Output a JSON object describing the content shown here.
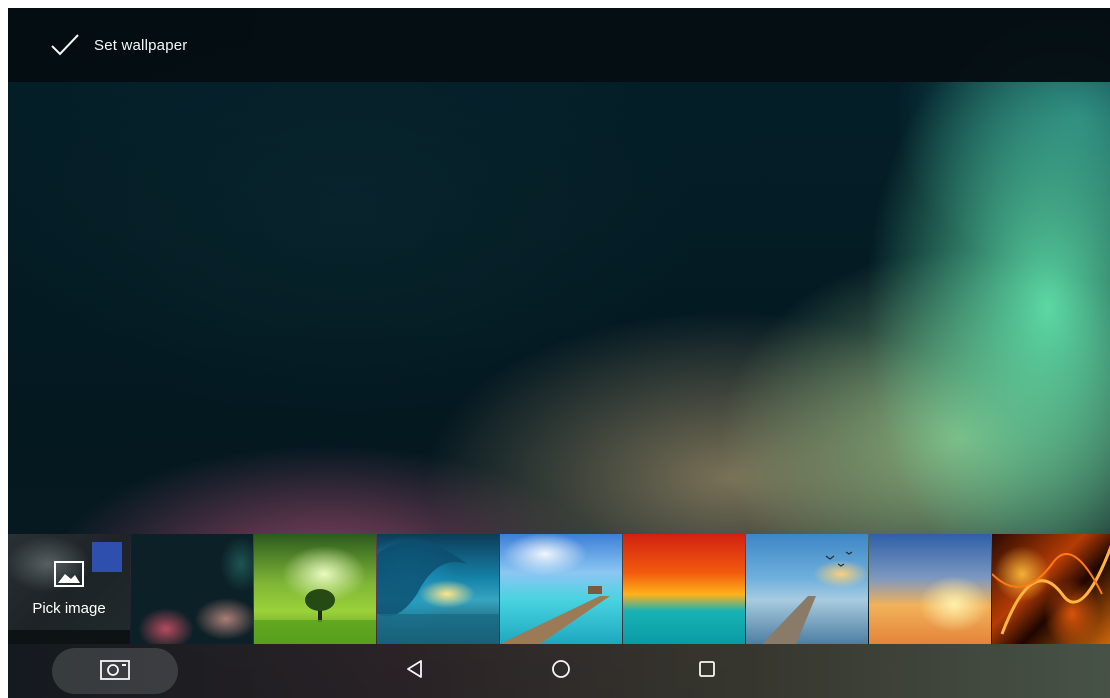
{
  "action_bar": {
    "set_wallpaper_label": "Set wallpaper",
    "icon": "check-icon"
  },
  "thumbnails": {
    "pick_image_label": "Pick image",
    "pick_image_icon": "picture-icon",
    "items": [
      {
        "name": "wallpaper-current"
      },
      {
        "name": "wallpaper-green-field-tree"
      },
      {
        "name": "wallpaper-ocean-wave"
      },
      {
        "name": "wallpaper-tropical-pier"
      },
      {
        "name": "wallpaper-red-sunset-sea"
      },
      {
        "name": "wallpaper-pier-birds"
      },
      {
        "name": "wallpaper-sky-sunburst"
      },
      {
        "name": "wallpaper-fire-abstract"
      }
    ]
  },
  "nav_bar": {
    "icons": [
      "camera-icon",
      "back-icon",
      "home-icon",
      "recents-icon"
    ]
  }
}
